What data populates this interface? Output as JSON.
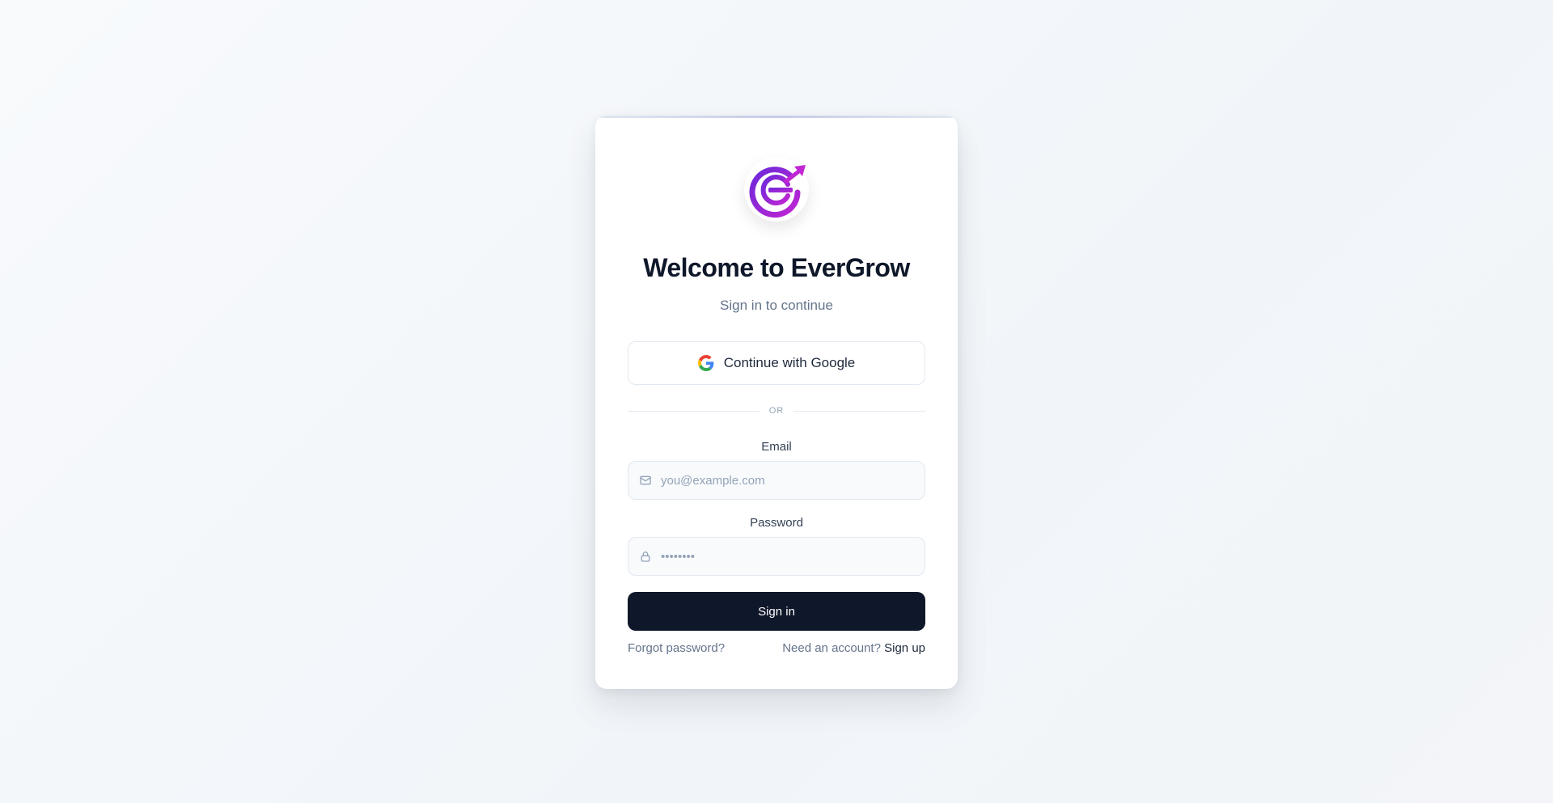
{
  "brand": {
    "logo_icon": "evergrow-logo-icon",
    "accent_color": "#a21caf"
  },
  "header": {
    "title": "Welcome to EverGrow",
    "subtitle": "Sign in to continue"
  },
  "google": {
    "label": "Continue with Google",
    "icon": "google-icon"
  },
  "divider": {
    "label": "OR"
  },
  "email": {
    "label": "Email",
    "placeholder": "you@example.com",
    "value": "",
    "icon": "mail-icon"
  },
  "password": {
    "label": "Password",
    "placeholder": "••••••••",
    "value": "",
    "icon": "lock-icon"
  },
  "signin": {
    "label": "Sign in",
    "color": "#0f172a"
  },
  "footer": {
    "forgot": "Forgot password?",
    "need_account": "Need an account?",
    "signup": "Sign up"
  }
}
